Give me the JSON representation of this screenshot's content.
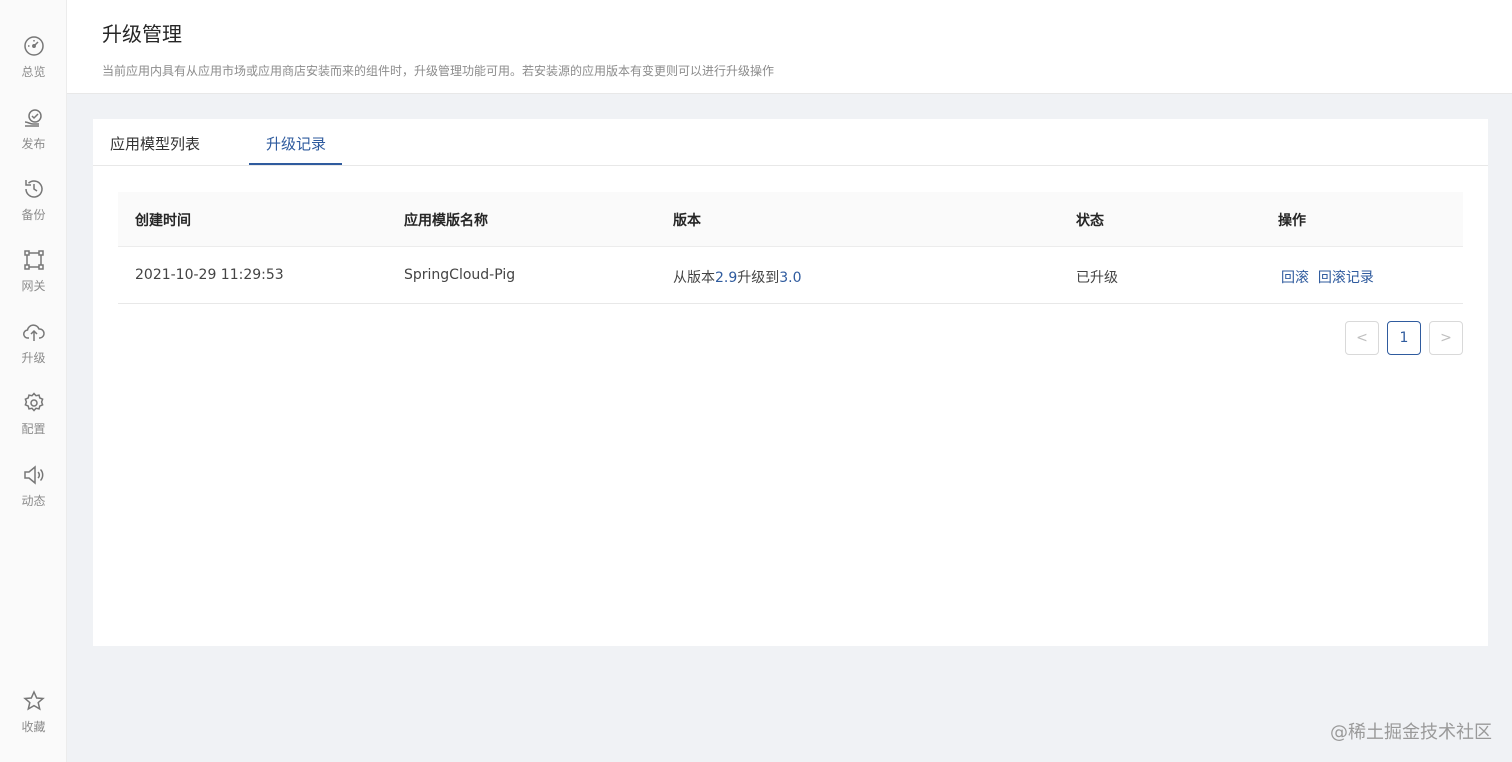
{
  "sidebar": {
    "items": [
      {
        "label": "总览",
        "icon": "dashboard-icon"
      },
      {
        "label": "发布",
        "icon": "publish-icon"
      },
      {
        "label": "备份",
        "icon": "backup-icon"
      },
      {
        "label": "网关",
        "icon": "gateway-icon"
      },
      {
        "label": "升级",
        "icon": "upgrade-cloud-icon"
      },
      {
        "label": "配置",
        "icon": "gear-icon"
      },
      {
        "label": "动态",
        "icon": "speaker-icon"
      }
    ],
    "favorite": {
      "label": "收藏",
      "icon": "star-icon"
    }
  },
  "header": {
    "title": "升级管理",
    "description": "当前应用内具有从应用市场或应用商店安装而来的组件时，升级管理功能可用。若安装源的应用版本有变更则可以进行升级操作"
  },
  "tabs": [
    {
      "label": "应用模型列表",
      "active": false
    },
    {
      "label": "升级记录",
      "active": true
    }
  ],
  "table": {
    "columns": [
      "创建时间",
      "应用模版名称",
      "版本",
      "状态",
      "操作"
    ],
    "rows": [
      {
        "created_at": "2021-10-29 11:29:53",
        "template_name": "SpringCloud-Pig",
        "version_prefix": "从版本",
        "from_version": "2.9",
        "version_mid": "升级到",
        "to_version": "3.0",
        "status": "已升级",
        "actions": [
          "回滚",
          "回滚记录"
        ]
      }
    ]
  },
  "pagination": {
    "prev": "<",
    "current": "1",
    "next": ">"
  },
  "watermark": "@稀土掘金技术社区",
  "colors": {
    "accent": "#2f5b9e",
    "text_muted": "#8c8c8c"
  }
}
